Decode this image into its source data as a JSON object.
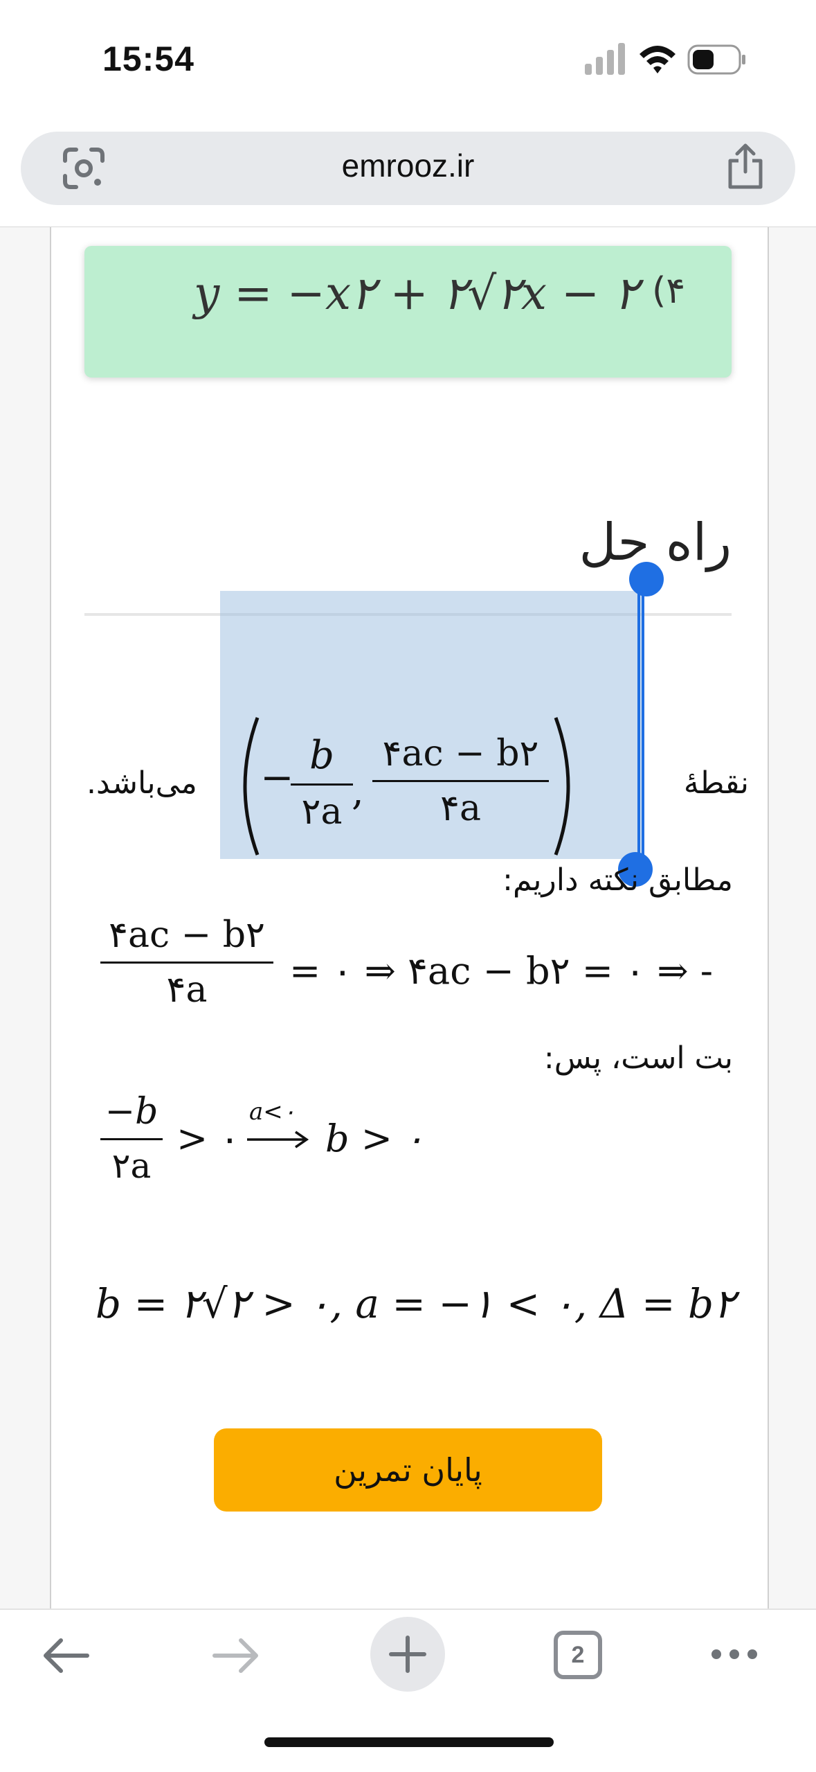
{
  "status_bar": {
    "time": "15:54"
  },
  "browser": {
    "url": "emrooz.ir",
    "tab_count": "2"
  },
  "option_4": {
    "number": "(۴",
    "formula": "y = −x۲ + ۲√۲x − ۲"
  },
  "solution": {
    "heading": "راه حل",
    "vertex_text_start": "نقطهٔ",
    "vertex_text_end": "می‌باشد.",
    "vertex_num1": "b",
    "vertex_den1": "۲a",
    "vertex_num2": "۴ac − b۲",
    "vertex_den2": "۴a",
    "line2": "مطابق نکته داریم:",
    "eq1_num": "۴ac − b۲",
    "eq1_den": "۴a",
    "eq1_rest": "= ۰ ⇒ ۴ac − b۲ = ۰ ⇒ -",
    "line3": "بت است، پس:",
    "eq2_num": "−b",
    "eq2_den": "۲a",
    "eq2_rest": "> ۰",
    "eq2_over": "a<۰",
    "eq2_end": "b > ۰",
    "eq3": "b = ۲√۲ > ۰, a = −۱ < ۰, Δ = b۲"
  },
  "finish_button": "پایان تمرین",
  "colors": {
    "formula_box": "#bdeed0",
    "button": "#fbad00",
    "selection": "#96b9de",
    "handles": "#1f6fe3"
  },
  "icons": [
    "google-lens-icon",
    "share-icon",
    "back-arrow-icon",
    "forward-arrow-icon",
    "new-tab-plus-icon",
    "tabs-count-icon",
    "more-menu-icon"
  ]
}
